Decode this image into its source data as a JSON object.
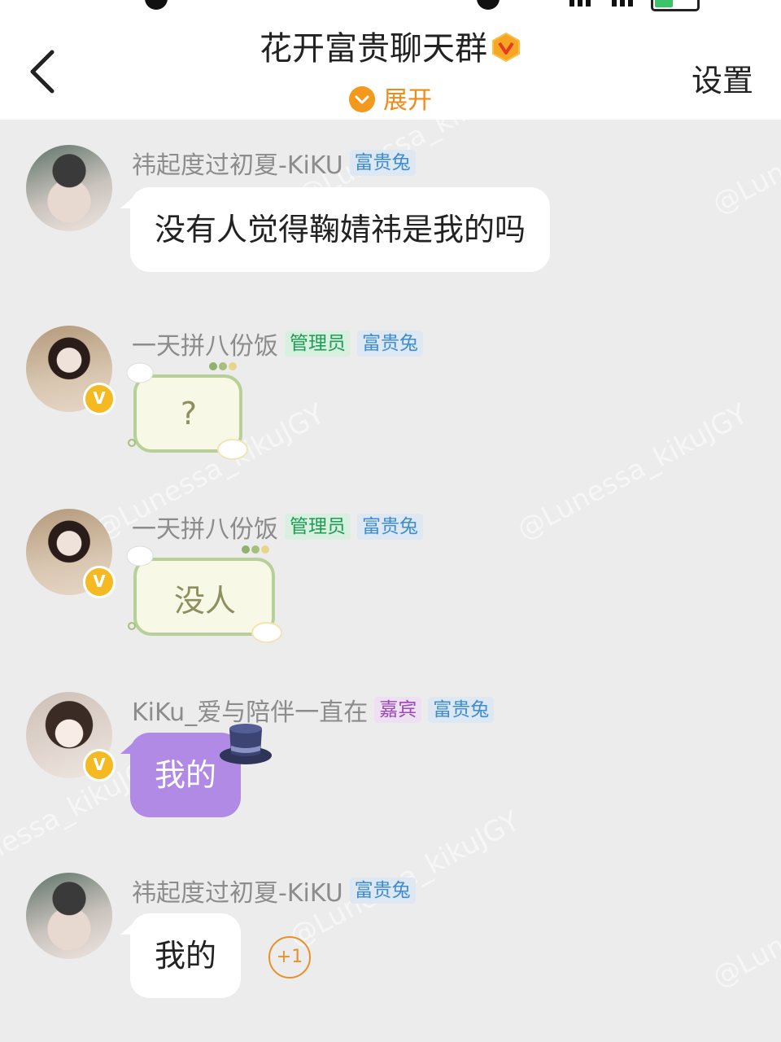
{
  "header": {
    "title": "花开富贵聊天群",
    "expand_label": "展开",
    "settings_label": "设置"
  },
  "watermark": "@Lunessa_kikuJGY",
  "messages": [
    {
      "sender": "祎起度过初夏-KiKU",
      "tags": [
        "富贵兔"
      ],
      "text": "没有人觉得鞠婧祎是我的吗"
    },
    {
      "sender": "一天拼八份饭",
      "tags": [
        "管理员",
        "富贵兔"
      ],
      "text": "?"
    },
    {
      "sender": "一天拼八份饭",
      "tags": [
        "管理员",
        "富贵兔"
      ],
      "text": "没人"
    },
    {
      "sender": "KiKu_爱与陪伴一直在",
      "tags": [
        "嘉宾",
        "富贵兔"
      ],
      "text": "我的"
    },
    {
      "sender": "祎起度过初夏-KiKU",
      "tags": [
        "富贵兔"
      ],
      "text": "我的",
      "reaction": "+1"
    }
  ],
  "colors": {
    "accent_orange": "#f08a18",
    "purple_bubble": "#b18ae6",
    "tag_blue": "#3f8ccf",
    "tag_green": "#1f9d57",
    "tag_purple": "#9c4ab8"
  },
  "icons": {
    "back": "chevron-left-icon",
    "verified": "v-badge-icon",
    "expand": "chevron-down-icon",
    "hat": "top-hat-icon"
  }
}
